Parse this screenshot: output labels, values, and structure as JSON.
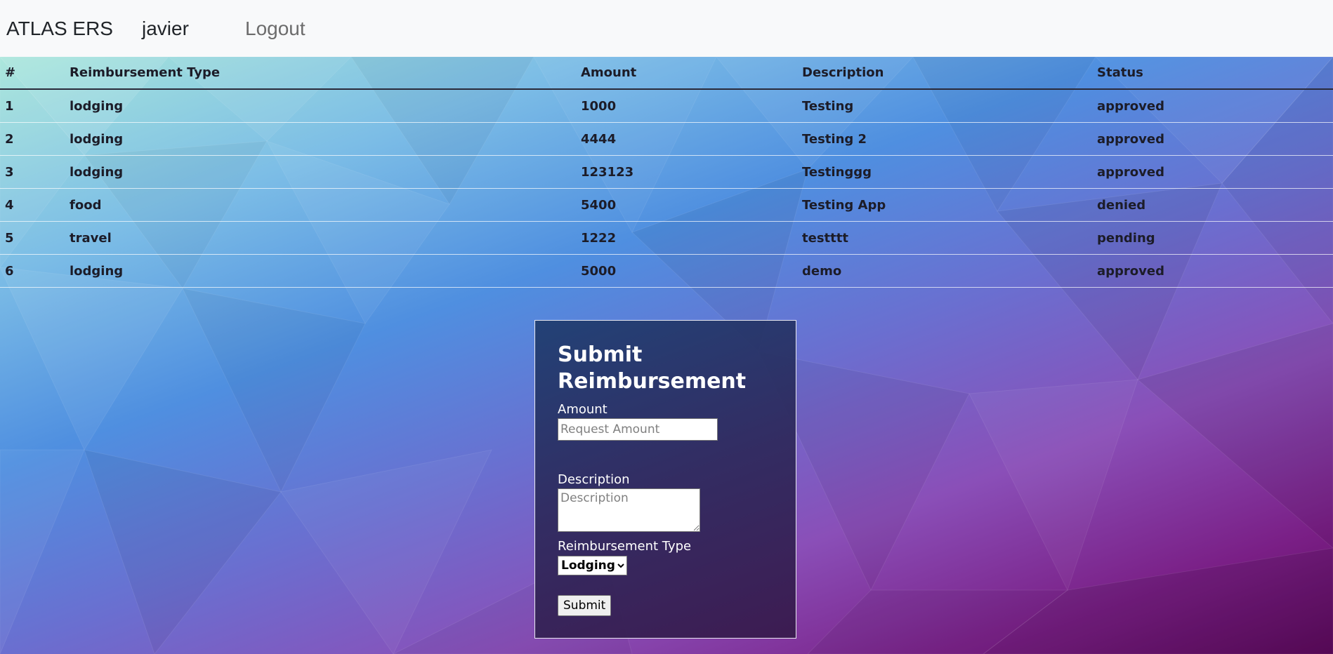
{
  "navbar": {
    "brand": "ATLAS ERS",
    "user": "javier",
    "logout": "Logout"
  },
  "table": {
    "headers": [
      "#",
      "Reimbursement Type",
      "Amount",
      "Description",
      "Status"
    ],
    "rows": [
      [
        "1",
        "lodging",
        "1000",
        "Testing",
        "approved"
      ],
      [
        "2",
        "lodging",
        "4444",
        "Testing 2",
        "approved"
      ],
      [
        "3",
        "lodging",
        "123123",
        "Testinggg",
        "approved"
      ],
      [
        "4",
        "food",
        "5400",
        "Testing App",
        "denied"
      ],
      [
        "5",
        "travel",
        "1222",
        "testttt",
        "pending"
      ],
      [
        "6",
        "lodging",
        "5000",
        "demo",
        "approved"
      ]
    ]
  },
  "form": {
    "title": "Submit Reimbursement",
    "amount_label": "Amount",
    "amount_placeholder": "Request Amount",
    "amount_value": "",
    "description_label": "Description",
    "description_placeholder": "Description",
    "description_value": "",
    "type_label": "Reimbursement Type",
    "type_selected": "Lodging",
    "submit_label": "Submit"
  }
}
